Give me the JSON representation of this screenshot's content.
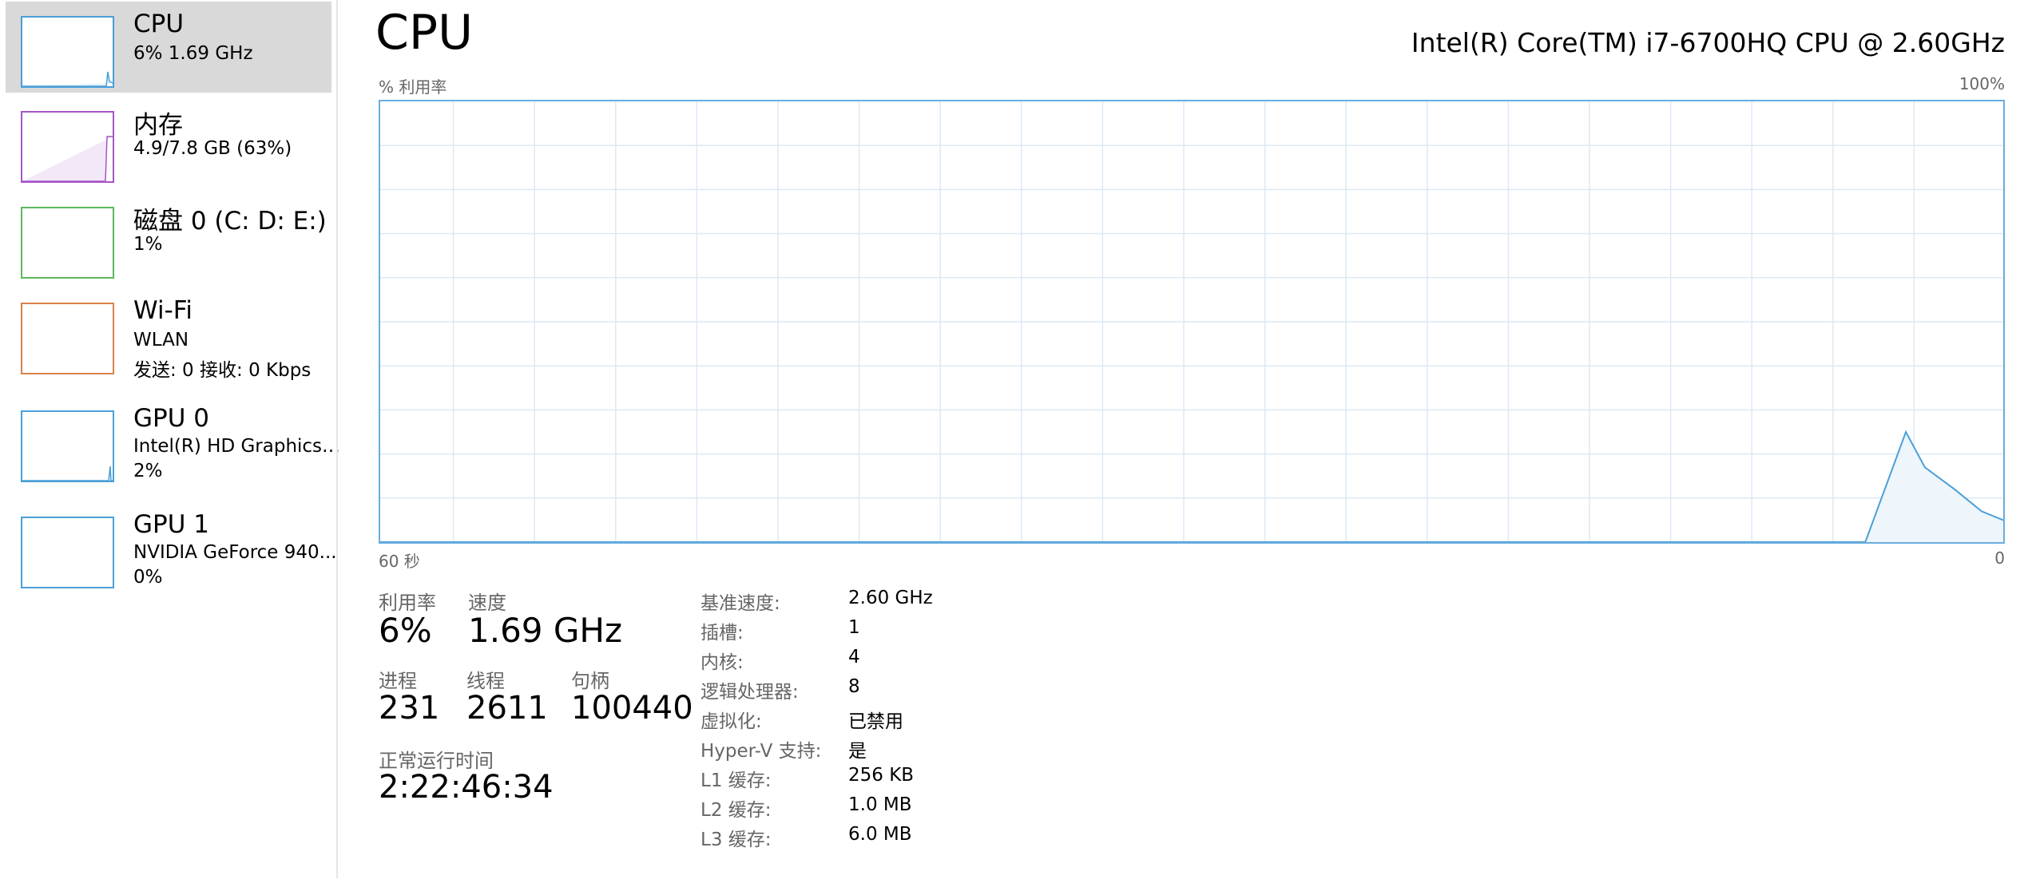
{
  "sidebar": {
    "items": [
      {
        "title": "CPU",
        "line1": "6% 1.69 GHz",
        "line2": "",
        "color": "#4a9fd8",
        "selected": true
      },
      {
        "title": "内存",
        "line1": "4.9/7.8 GB (63%)",
        "line2": "",
        "color": "#a855c7",
        "selected": false
      },
      {
        "title": "磁盘 0 (C: D: E:)",
        "line1": "1%",
        "line2": "",
        "color": "#5cb85c",
        "selected": false
      },
      {
        "title": "Wi-Fi",
        "line1": "WLAN",
        "line2": "发送: 0 接收: 0 Kbps",
        "color": "#d9824a",
        "selected": false
      },
      {
        "title": "GPU 0",
        "line1": "Intel(R) HD Graphics ...",
        "line2": "2%",
        "color": "#4a9fd8",
        "selected": false
      },
      {
        "title": "GPU 1",
        "line1": "NVIDIA GeForce 940...",
        "line2": "0%",
        "color": "#4a9fd8",
        "selected": false
      }
    ]
  },
  "main": {
    "title": "CPU",
    "cpu_model": "Intel(R) Core(TM) i7-6700HQ CPU @ 2.60GHz",
    "graph": {
      "y_label": "% 利用率",
      "y_max_label": "100%",
      "x_left_label": "60 秒",
      "x_right_label": "0",
      "line_color": "#4a9fd8"
    },
    "stats": {
      "utilization_label": "利用率",
      "utilization_value": "6%",
      "speed_label": "速度",
      "speed_value": "1.69 GHz",
      "processes_label": "进程",
      "processes_value": "231",
      "threads_label": "线程",
      "threads_value": "2611",
      "handles_label": "句柄",
      "handles_value": "100440",
      "uptime_label": "正常运行时间",
      "uptime_value": "2:22:46:34"
    },
    "specs": [
      {
        "key": "基准速度:",
        "value": "2.60 GHz"
      },
      {
        "key": "插槽:",
        "value": "1"
      },
      {
        "key": "内核:",
        "value": "4"
      },
      {
        "key": "逻辑处理器:",
        "value": "8"
      },
      {
        "key": "虚拟化:",
        "value": "已禁用"
      },
      {
        "key": "Hyper-V 支持:",
        "value": "是"
      },
      {
        "key": "L1 缓存:",
        "value": "256 KB"
      },
      {
        "key": "L2 缓存:",
        "value": "1.0 MB"
      },
      {
        "key": "L3 缓存:",
        "value": "6.0 MB"
      }
    ]
  },
  "chart_data": {
    "type": "area",
    "xlabel": "",
    "ylabel": "% 利用率",
    "xlim": [
      60,
      0
    ],
    "ylim": [
      0,
      100
    ],
    "x": [
      60,
      5.1,
      3.6,
      2.9,
      1.8,
      0.8,
      0,
      -1.2
    ],
    "series": [
      {
        "values": [
          0,
          0,
          25,
          17,
          12,
          7,
          5,
          7
        ]
      }
    ]
  }
}
